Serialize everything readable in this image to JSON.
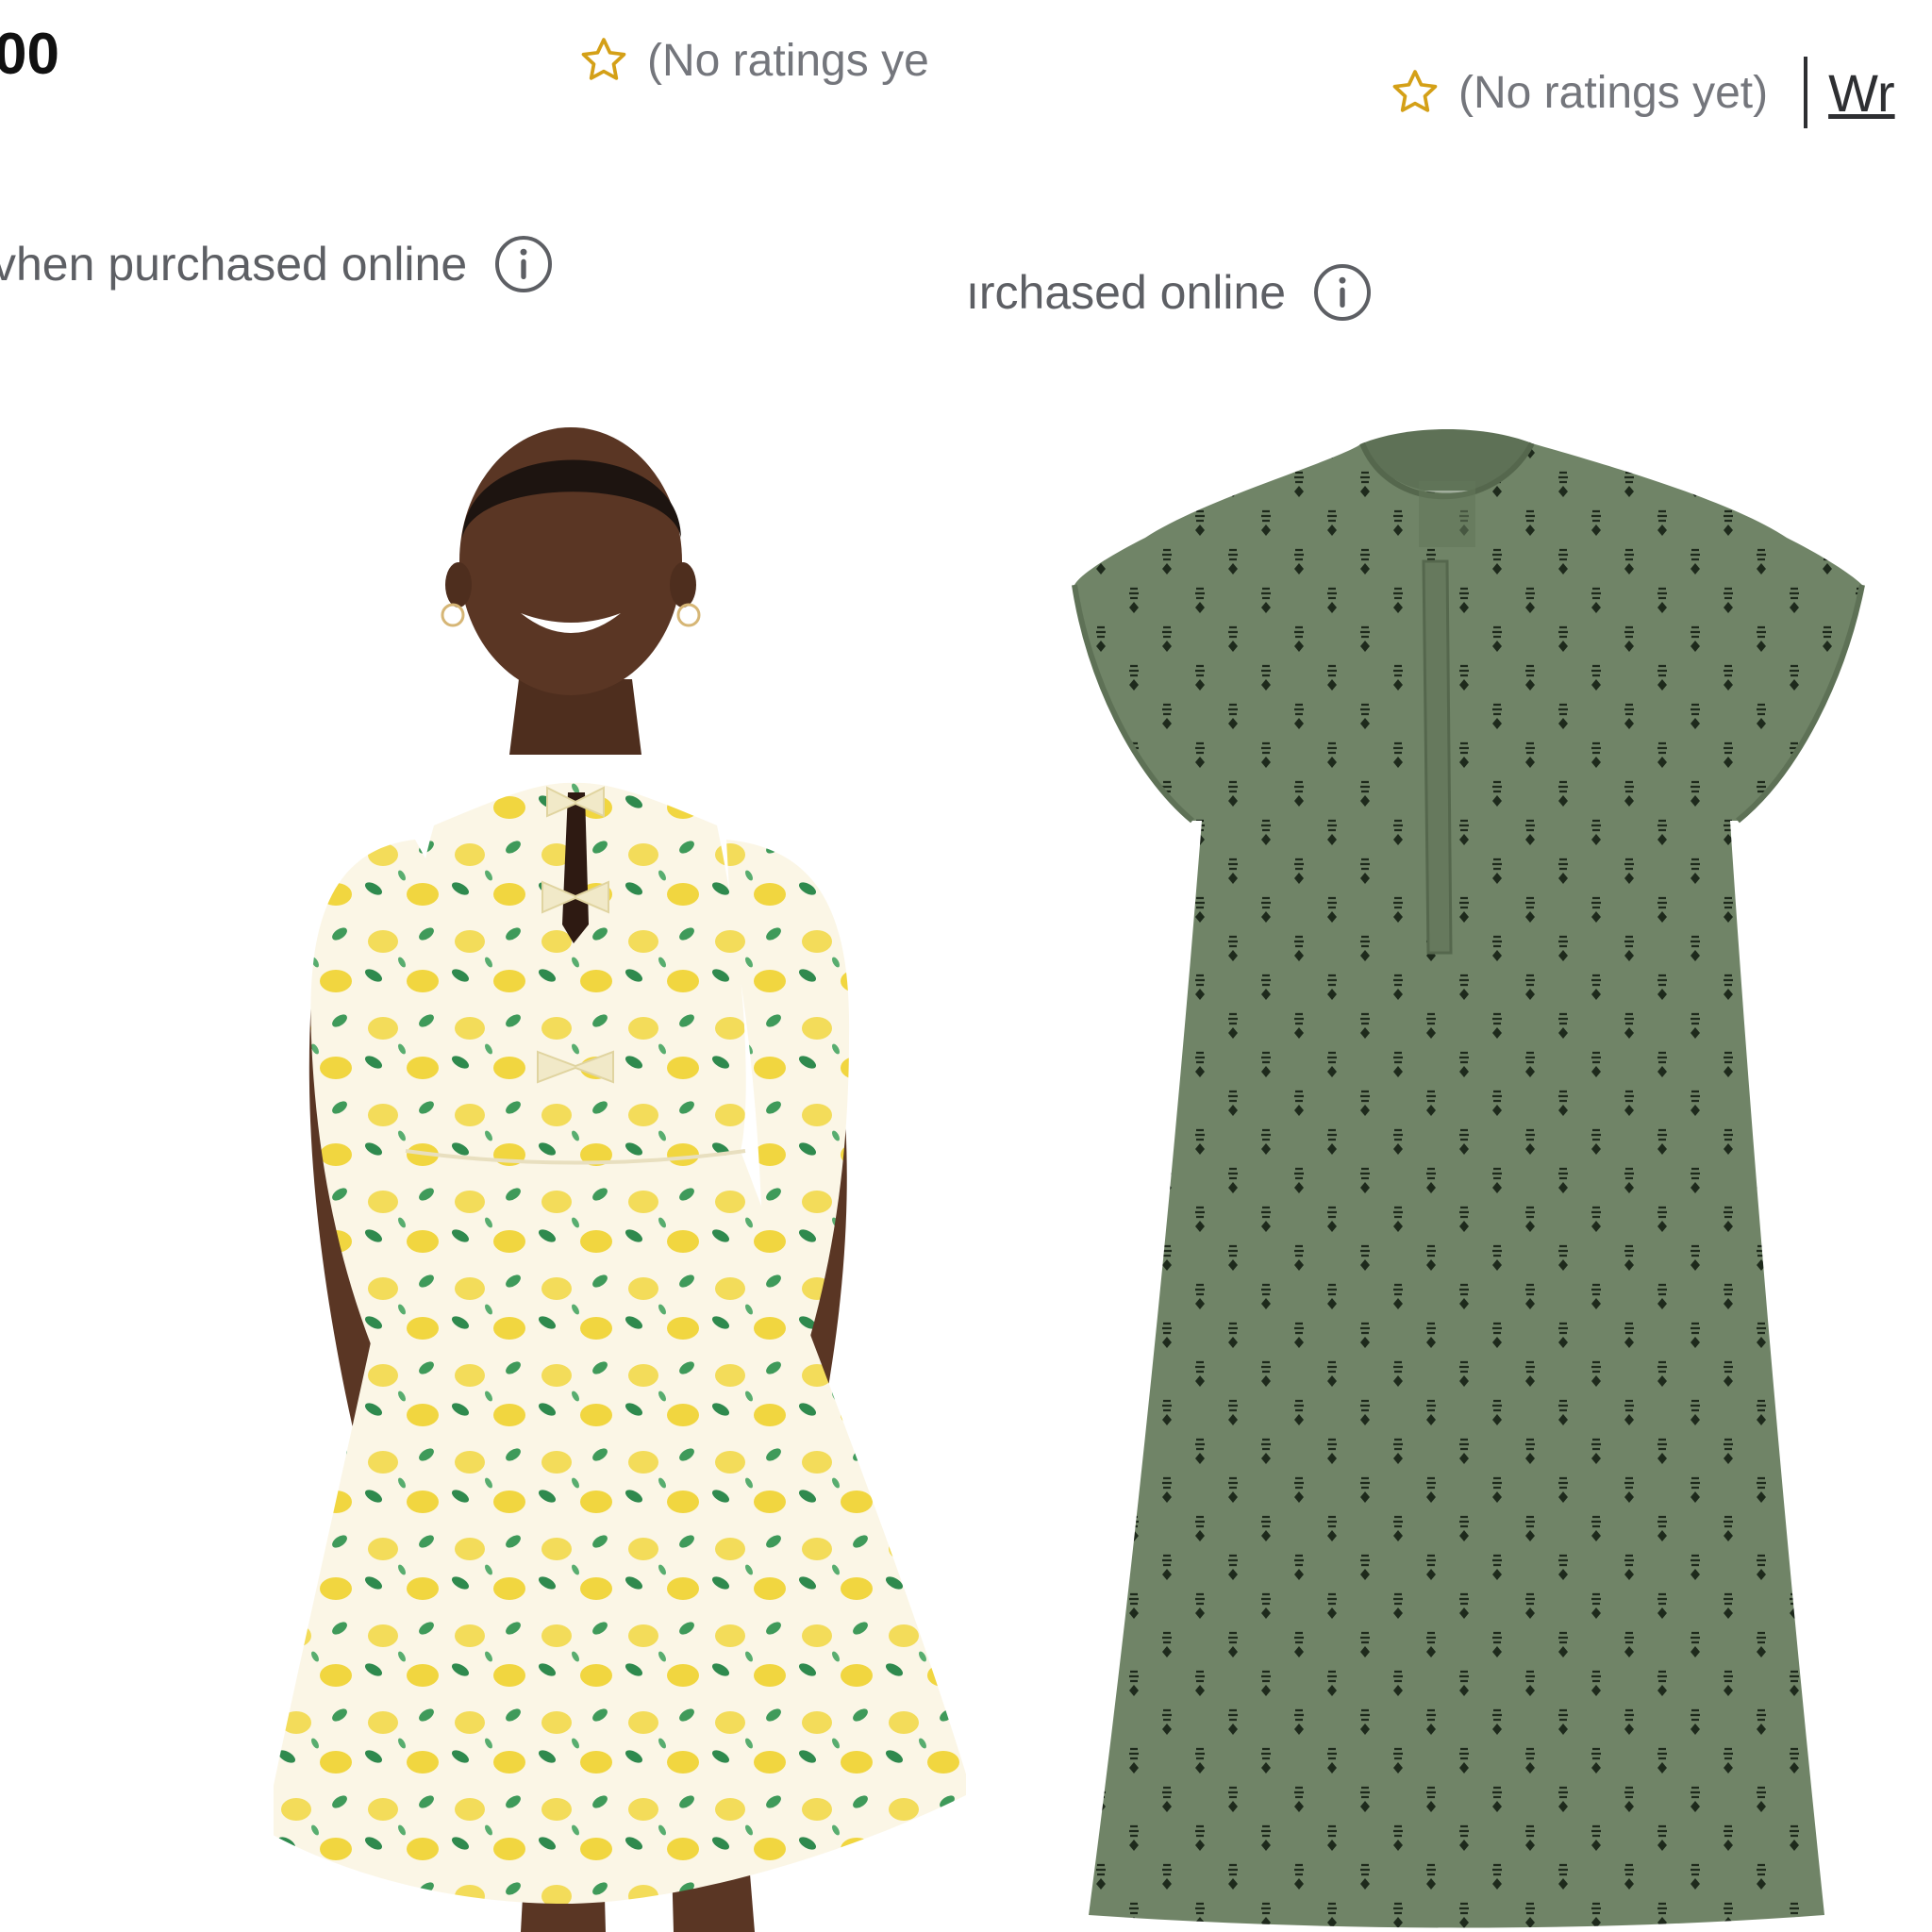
{
  "left_product": {
    "price": "00",
    "rating": {
      "icon": "star-outline-icon",
      "text": "(No ratings ye"
    },
    "shipping_note": {
      "text": "vhen purchased online",
      "icon": "info-icon"
    },
    "image": {
      "label": "Yellow lemon print puff sleeve babydoll mini dress with front bow ties, worn by smiling model"
    }
  },
  "right_product": {
    "rating": {
      "icon": "star-outline-icon",
      "text": "(No ratings yet)",
      "link": "Wr"
    },
    "shipping_note": {
      "text": "ırchased online",
      "icon": "info-icon"
    },
    "image": {
      "label": "Olive green flutter sleeve shift dress with small black geometric print"
    }
  },
  "colors": {
    "star": "#d4a017",
    "muted_text": "#74767c",
    "lemon_yellow": "#f3dc5a",
    "leaf_green": "#3f9a5a",
    "dress_cream": "#fbf6e6",
    "olive": "#708467",
    "skin": "#5a3624"
  }
}
